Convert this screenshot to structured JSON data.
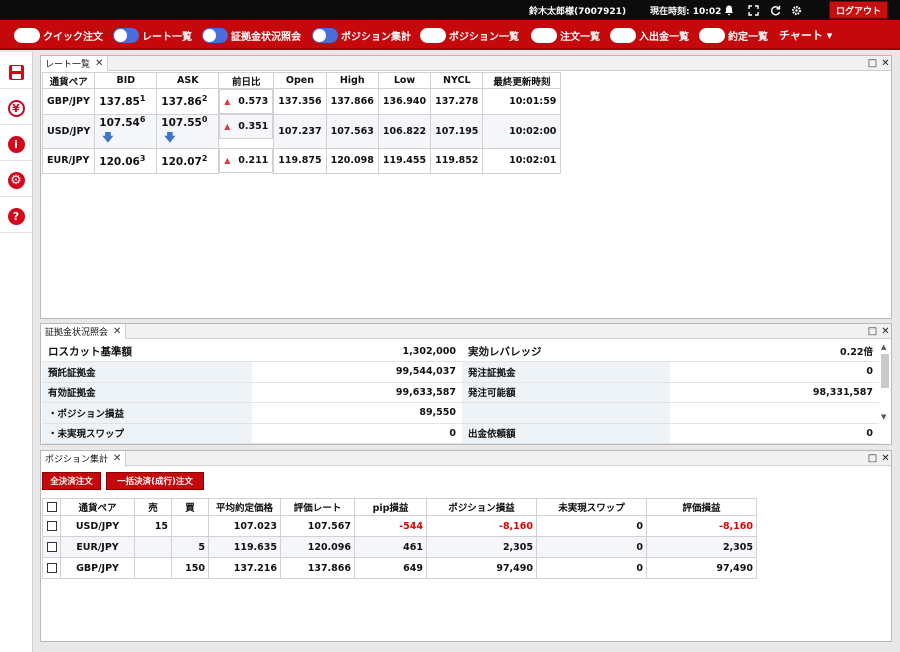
{
  "topbar": {
    "user": "鈴木太郎様(7007921)",
    "clock_label": "現在時刻: 10:02",
    "icons": [
      "bell-icon",
      "fullscreen-icon",
      "refresh-icon",
      "gear-icon"
    ],
    "logout": "ログアウト"
  },
  "menu": {
    "items": [
      {
        "label": "クイック注文",
        "on": false
      },
      {
        "label": "レート一覧",
        "on": true
      },
      {
        "label": "証拠金状況照会",
        "on": true
      },
      {
        "label": "ポジション集計",
        "on": true
      },
      {
        "label": "ポジション一覧",
        "on": false
      },
      {
        "label": "注文一覧",
        "on": false
      },
      {
        "label": "入出金一覧",
        "on": false
      },
      {
        "label": "約定一覧",
        "on": false
      }
    ],
    "chart": "チャート",
    "chart_arrow": "▾"
  },
  "sidebar": {
    "icons": [
      "save-icon",
      "yen-icon",
      "info-icon",
      "settings-icon",
      "help-icon"
    ],
    "yen_glyph": "¥",
    "info_glyph": "i",
    "help_glyph": "?",
    "gear_glyph": "⚙"
  },
  "colors": {
    "brand_red": "#c5080c",
    "toggle_on": "#4a6ddb",
    "negative": "#e00000",
    "down_arrow": "#3d75c7"
  },
  "rates": {
    "tab": "レート一覧",
    "headers": [
      "通貨ペア",
      "BID",
      "ASK",
      "前日比",
      "Open",
      "High",
      "Low",
      "NYCL",
      "最終更新時刻"
    ],
    "rows": [
      {
        "pair": "GBP/JPY",
        "bid": "137.85",
        "bid_sup": "1",
        "bid_dir": "",
        "ask": "137.86",
        "ask_sup": "2",
        "ask_dir": "",
        "change": "0.573",
        "open": "137.356",
        "high": "137.866",
        "low": "136.940",
        "nycl": "137.278",
        "time": "10:01:59"
      },
      {
        "pair": "USD/JPY",
        "bid": "107.54",
        "bid_sup": "6",
        "bid_dir": "down",
        "ask": "107.55",
        "ask_sup": "0",
        "ask_dir": "down",
        "change": "0.351",
        "open": "107.237",
        "high": "107.563",
        "low": "106.822",
        "nycl": "107.195",
        "time": "10:02:00"
      },
      {
        "pair": "EUR/JPY",
        "bid": "120.06",
        "bid_sup": "3",
        "bid_dir": "",
        "ask": "120.07",
        "ask_sup": "2",
        "ask_dir": "",
        "change": "0.211",
        "open": "119.875",
        "high": "120.098",
        "low": "119.455",
        "nycl": "119.852",
        "time": "10:02:01"
      }
    ]
  },
  "margin": {
    "tab": "証拠金状況照会",
    "rows": [
      {
        "l1": "ロスカット基準額",
        "v1": "1,302,000",
        "l2": "実効レバレッジ",
        "v2": "0.22倍"
      },
      {
        "l1": "預託証拠金",
        "v1": "99,544,037",
        "l2": "発注証拠金",
        "v2": "0"
      },
      {
        "l1": "有効証拠金",
        "v1": "99,633,587",
        "l2": "発注可能額",
        "v2": "98,331,587"
      },
      {
        "l1": "・ポジション損益",
        "v1": "89,550",
        "l2": "",
        "v2": ""
      },
      {
        "l1": "・未実現スワップ",
        "v1": "0",
        "l2": "出金依頼額",
        "v2": "0"
      }
    ]
  },
  "positions": {
    "tab": "ポジション集計",
    "btn_all": "全決済注文",
    "btn_bulk": "一括決済(成行)注文",
    "headers": [
      "",
      "通貨ペア",
      "売",
      "買",
      "平均約定価格",
      "評価レート",
      "pip損益",
      "ポジション損益",
      "未実現スワップ",
      "評価損益"
    ],
    "rows": [
      {
        "pair": "USD/JPY",
        "sell": "15",
        "buy": "",
        "avg": "107.023",
        "rate": "107.567",
        "pip": "-544",
        "pl": "-8,160",
        "swap": "0",
        "eval": "-8,160"
      },
      {
        "pair": "EUR/JPY",
        "sell": "",
        "buy": "5",
        "avg": "119.635",
        "rate": "120.096",
        "pip": "461",
        "pl": "2,305",
        "swap": "0",
        "eval": "2,305"
      },
      {
        "pair": "GBP/JPY",
        "sell": "",
        "buy": "150",
        "avg": "137.216",
        "rate": "137.866",
        "pip": "649",
        "pl": "97,490",
        "swap": "0",
        "eval": "97,490"
      }
    ]
  }
}
